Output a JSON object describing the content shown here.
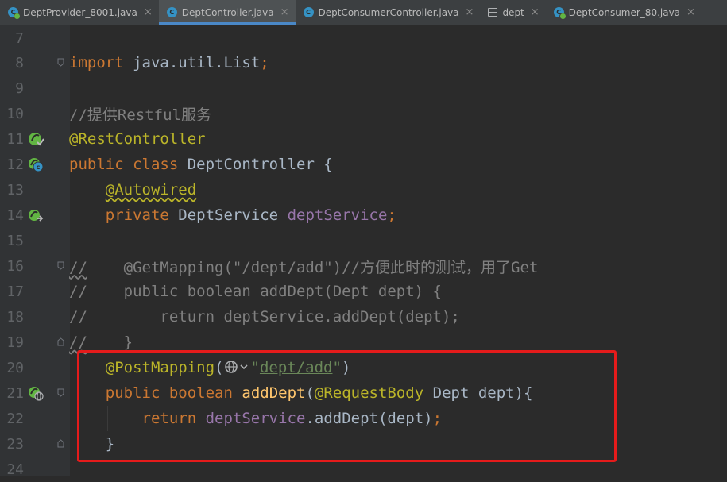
{
  "tabs": [
    {
      "label": "DeptProvider_8001.java",
      "icon": "spring-boot-icon",
      "active": false
    },
    {
      "label": "DeptController.java",
      "icon": "java-class-icon",
      "active": true
    },
    {
      "label": "DeptConsumerController.java",
      "icon": "java-class-icon",
      "active": false
    },
    {
      "label": "dept",
      "icon": "db-table-icon",
      "active": false
    },
    {
      "label": "DeptConsumer_80.java",
      "icon": "spring-boot-icon",
      "active": false
    }
  ],
  "tab_close_glyph": "×",
  "lines": [
    {
      "n": "7"
    },
    {
      "n": "8",
      "t": {
        "kw": "import",
        "rest": " java.util.List",
        "semi": ";"
      }
    },
    {
      "n": "9"
    },
    {
      "n": "10",
      "t": {
        "comment": "//提供Restful服务"
      }
    },
    {
      "n": "11",
      "t": {
        "ann": "@RestController"
      }
    },
    {
      "n": "12",
      "t": {
        "kw1": "public",
        "kw2": "class",
        "name": " DeptController {"
      }
    },
    {
      "n": "13",
      "t": {
        "ann": "@Autowired"
      }
    },
    {
      "n": "14",
      "t": {
        "kw": "private",
        "type": " DeptService ",
        "field": "deptService",
        "semi": ";"
      }
    },
    {
      "n": "15"
    },
    {
      "n": "16",
      "t": {
        "c1": "//",
        "c2": "    @GetMapping(\"/dept/add\")//方便此时的测试，用了Get"
      }
    },
    {
      "n": "17",
      "t": {
        "comment": "//    public boolean addDept(Dept dept) {"
      }
    },
    {
      "n": "18",
      "t": {
        "comment": "//        return deptService.addDept(dept);"
      }
    },
    {
      "n": "19",
      "t": {
        "c1": "//",
        "c2": "    }"
      }
    },
    {
      "n": "20",
      "t": {
        "ann": "@PostMapping",
        "paren": "(",
        "q1": "\"",
        "url": "dept/add",
        "q2": "\"",
        "close": ")"
      }
    },
    {
      "n": "21",
      "t": {
        "kw1": "public",
        "kw2": "boolean",
        "meth": "addDept",
        "p1": "(",
        "ann": "@RequestBody",
        "rest": " Dept dept){"
      }
    },
    {
      "n": "22",
      "t": {
        "kw": "return",
        "field": "deptService",
        "rest": ".addDept(dept)",
        "semi": ";"
      }
    },
    {
      "n": "23",
      "t": {
        "brace": "}"
      }
    },
    {
      "n": "24"
    }
  ],
  "colors": {
    "background": "#2b2b2b",
    "keyword": "#cc7832",
    "annotation": "#bbb529",
    "comment": "#808080",
    "field": "#9876aa",
    "method": "#ffc66d",
    "string": "#6a8759",
    "highlight_box": "#e51b1b"
  }
}
